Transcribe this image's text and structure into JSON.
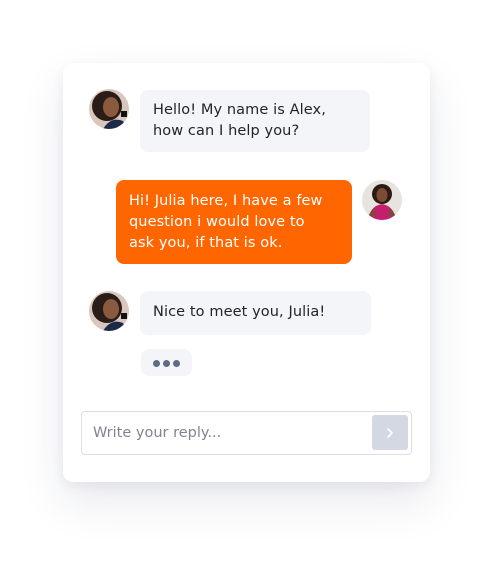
{
  "messages": [
    {
      "sender": "agent",
      "lines": [
        "Hello! My name is Alex,",
        "how can I help you?"
      ]
    },
    {
      "sender": "user",
      "lines": [
        "Hi! Julia here, I have a few",
        "question i would love to",
        "ask you, if that is ok."
      ]
    },
    {
      "sender": "agent",
      "lines": [
        "Nice to meet you, Julia!"
      ]
    }
  ],
  "typing_indicator": {
    "visible": true
  },
  "reply": {
    "placeholder": "Write your reply...",
    "value": "",
    "send_icon": "chevron-right-icon"
  },
  "colors": {
    "accent": "#ff6600",
    "agent_bubble": "#f4f5f8",
    "send_button": "#d3d8e3",
    "typing_dot": "#5c6c85"
  }
}
